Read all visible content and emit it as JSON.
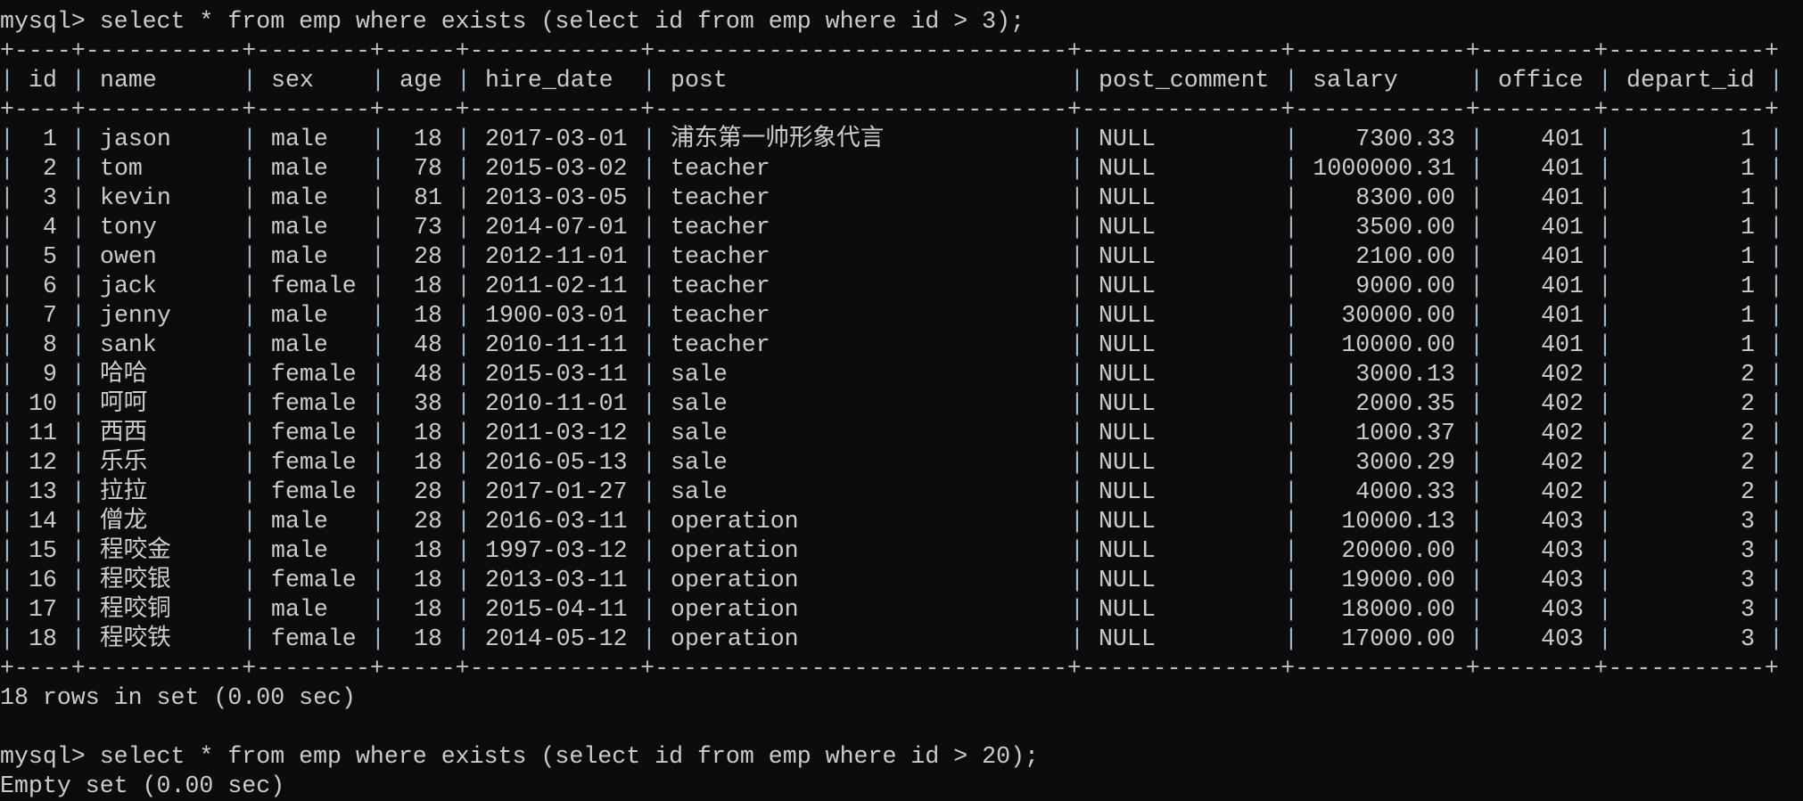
{
  "terminal": {
    "background": "#0c0c0c",
    "foreground": "#cccccc",
    "command1": "mysql> select * from emp where exists (select id from emp where id > 3);",
    "result1_status": "18 rows in set (0.00 sec)",
    "command2": "mysql> select * from emp where exists (select id from emp where id > 20);",
    "result2_status": "Empty set (0.00 sec)"
  },
  "table": {
    "columns": [
      "id",
      "name",
      "sex",
      "age",
      "hire_date",
      "post",
      "post_comment",
      "salary",
      "office",
      "depart_id"
    ],
    "rows": [
      [
        "1",
        "jason",
        "male",
        "18",
        "2017-03-01",
        "浦东第一帅形象代言",
        "NULL",
        "7300.33",
        "401",
        "1"
      ],
      [
        "2",
        "tom",
        "male",
        "78",
        "2015-03-02",
        "teacher",
        "NULL",
        "1000000.31",
        "401",
        "1"
      ],
      [
        "3",
        "kevin",
        "male",
        "81",
        "2013-03-05",
        "teacher",
        "NULL",
        "8300.00",
        "401",
        "1"
      ],
      [
        "4",
        "tony",
        "male",
        "73",
        "2014-07-01",
        "teacher",
        "NULL",
        "3500.00",
        "401",
        "1"
      ],
      [
        "5",
        "owen",
        "male",
        "28",
        "2012-11-01",
        "teacher",
        "NULL",
        "2100.00",
        "401",
        "1"
      ],
      [
        "6",
        "jack",
        "female",
        "18",
        "2011-02-11",
        "teacher",
        "NULL",
        "9000.00",
        "401",
        "1"
      ],
      [
        "7",
        "jenny",
        "male",
        "18",
        "1900-03-01",
        "teacher",
        "NULL",
        "30000.00",
        "401",
        "1"
      ],
      [
        "8",
        "sank",
        "male",
        "48",
        "2010-11-11",
        "teacher",
        "NULL",
        "10000.00",
        "401",
        "1"
      ],
      [
        "9",
        "哈哈",
        "female",
        "48",
        "2015-03-11",
        "sale",
        "NULL",
        "3000.13",
        "402",
        "2"
      ],
      [
        "10",
        "呵呵",
        "female",
        "38",
        "2010-11-01",
        "sale",
        "NULL",
        "2000.35",
        "402",
        "2"
      ],
      [
        "11",
        "西西",
        "female",
        "18",
        "2011-03-12",
        "sale",
        "NULL",
        "1000.37",
        "402",
        "2"
      ],
      [
        "12",
        "乐乐",
        "female",
        "18",
        "2016-05-13",
        "sale",
        "NULL",
        "3000.29",
        "402",
        "2"
      ],
      [
        "13",
        "拉拉",
        "female",
        "28",
        "2017-01-27",
        "sale",
        "NULL",
        "4000.33",
        "402",
        "2"
      ],
      [
        "14",
        "僧龙",
        "male",
        "28",
        "2016-03-11",
        "operation",
        "NULL",
        "10000.13",
        "403",
        "3"
      ],
      [
        "15",
        "程咬金",
        "male",
        "18",
        "1997-03-12",
        "operation",
        "NULL",
        "20000.00",
        "403",
        "3"
      ],
      [
        "16",
        "程咬银",
        "female",
        "18",
        "2013-03-11",
        "operation",
        "NULL",
        "19000.00",
        "403",
        "3"
      ],
      [
        "17",
        "程咬铜",
        "male",
        "18",
        "2015-04-11",
        "operation",
        "NULL",
        "18000.00",
        "403",
        "3"
      ],
      [
        "18",
        "程咬铁",
        "female",
        "18",
        "2014-05-12",
        "operation",
        "NULL",
        "17000.00",
        "403",
        "3"
      ]
    ]
  }
}
